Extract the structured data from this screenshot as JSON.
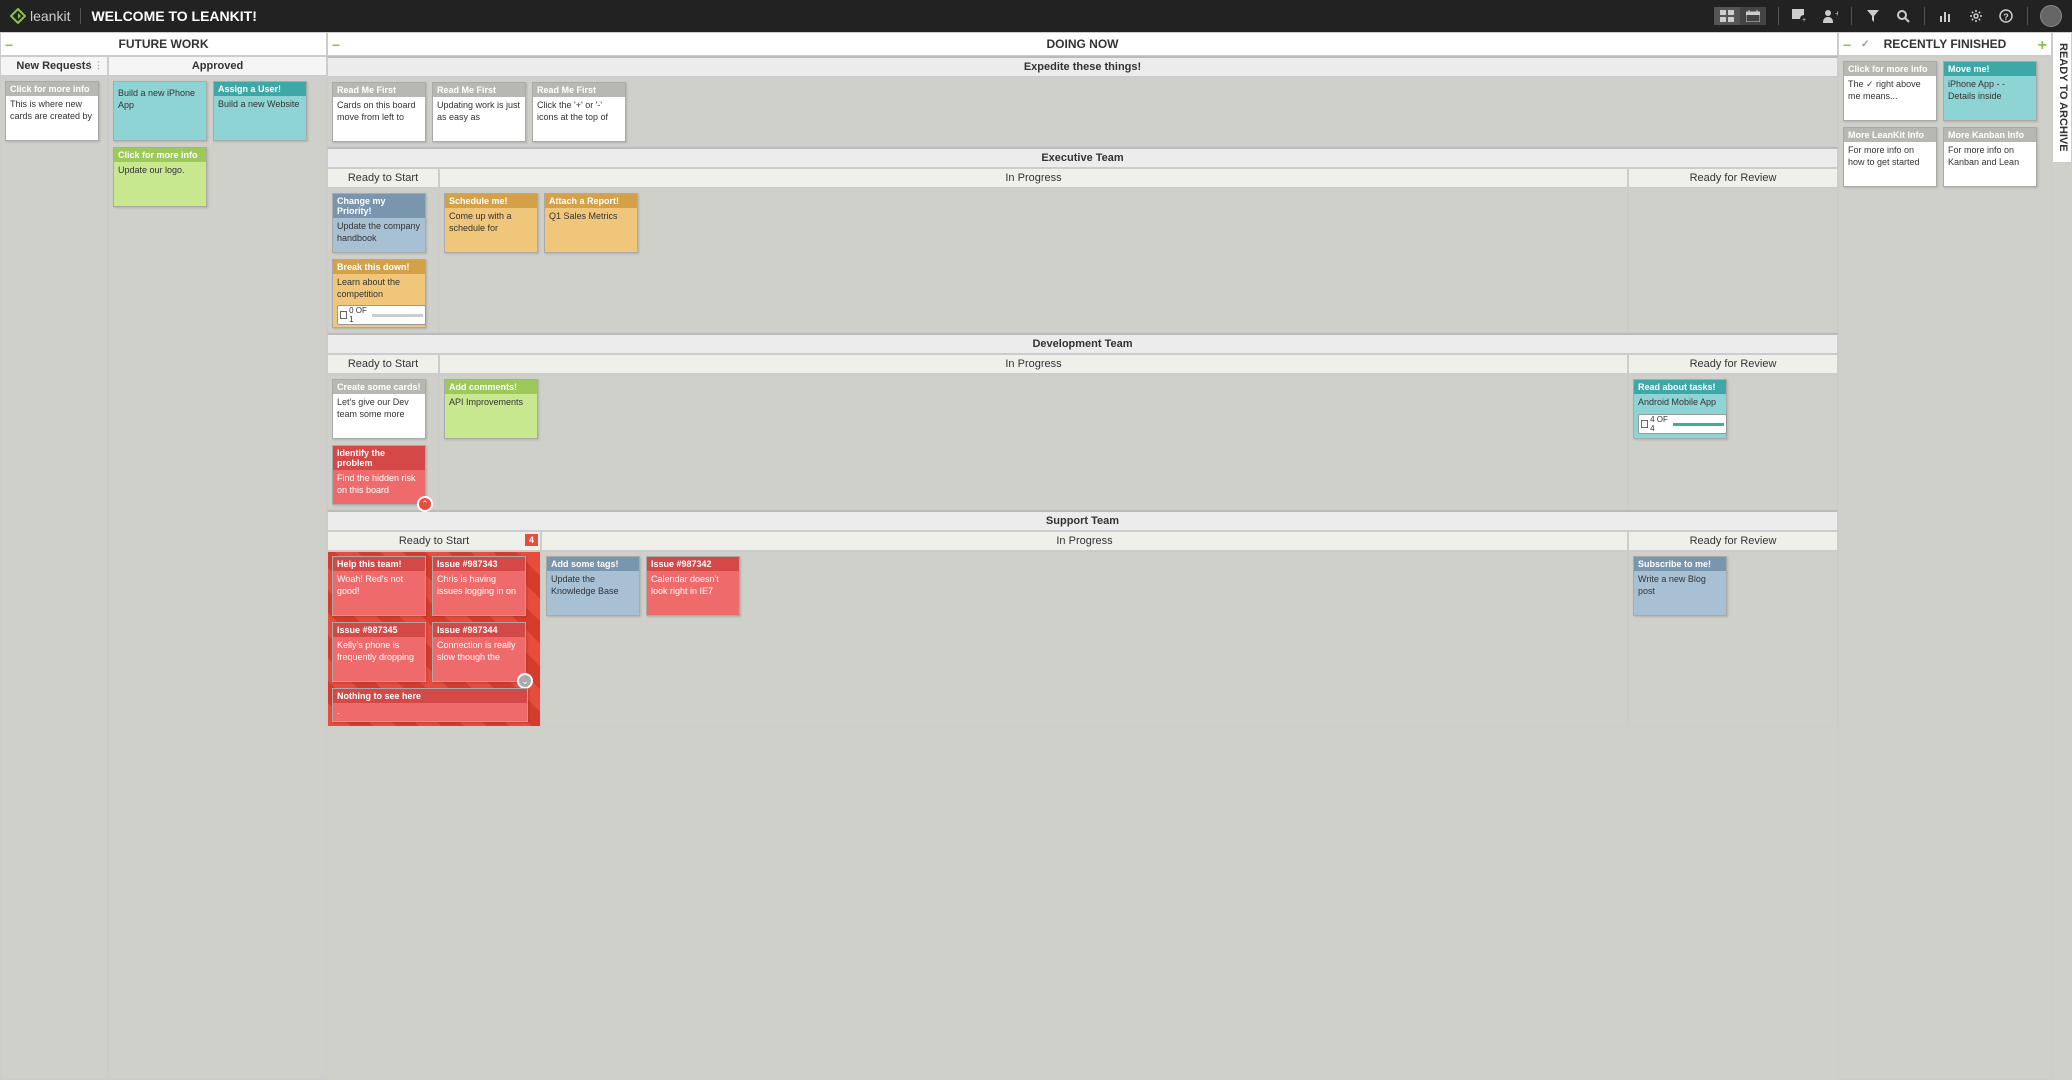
{
  "header": {
    "logo_text": "leankit",
    "title": "WELCOME TO LEANKIT!"
  },
  "groups": {
    "future": {
      "title": "FUTURE WORK"
    },
    "doing": {
      "title": "DOING NOW"
    },
    "recent": {
      "title": "RECENTLY FINISHED"
    },
    "archive": {
      "title": "READY TO ARCHIVE"
    }
  },
  "future": {
    "new_requests": {
      "title": "New Requests",
      "card1": {
        "hdr": "Click for more info",
        "body": "This is where new cards are created by"
      }
    },
    "approved": {
      "title": "Approved",
      "card1": {
        "body": "Build a new iPhone App"
      },
      "card2": {
        "hdr": "Assign a User!",
        "body": "Build a new Website"
      },
      "card3": {
        "hdr": "Click for more info",
        "body": "Update our logo."
      }
    }
  },
  "doing": {
    "expedite": {
      "title": "Expedite these things!",
      "card1": {
        "hdr": "Read Me First",
        "body": "Cards on this board move from left to"
      },
      "card2": {
        "hdr": "Read Me First",
        "body": "Updating work is just as easy as"
      },
      "card3": {
        "hdr": "Read Me First",
        "body": "Click the '+' or '-' icons at the top of"
      }
    },
    "exec": {
      "title": "Executive Team",
      "cols": {
        "ready": "Ready to Start",
        "progress": "In Progress",
        "review": "Ready for Review"
      },
      "ready": {
        "c1": {
          "hdr": "Change my Priority!",
          "body": "Update the company handbook"
        },
        "c2": {
          "hdr": "Break this down!",
          "body": "Learn about the competition",
          "task": "0 OF 1"
        }
      },
      "progress": {
        "c1": {
          "hdr": "Schedule me!",
          "body": "Come up with a schedule for"
        },
        "c2": {
          "hdr": "Attach a Report!",
          "body": "Q1 Sales Metrics"
        }
      }
    },
    "dev": {
      "title": "Development Team",
      "cols": {
        "ready": "Ready to Start",
        "progress": "In Progress",
        "review": "Ready for Review"
      },
      "ready": {
        "c1": {
          "hdr": "Create some cards!",
          "body": "Let's give our Dev team some more"
        },
        "c2": {
          "hdr": "Identify the problem",
          "body": "Find the hidden risk on this board"
        }
      },
      "progress": {
        "c1": {
          "hdr": "Add comments!",
          "body": "API Improvements"
        }
      },
      "review": {
        "c1": {
          "hdr": "Read about tasks!",
          "body": "Android Mobile App",
          "task": "4 OF 4"
        }
      }
    },
    "support": {
      "title": "Support Team",
      "cols": {
        "ready": "Ready to Start",
        "progress": "In Progress",
        "review": "Ready for Review"
      },
      "wip": "4",
      "ready": {
        "c1": {
          "hdr": "Help this team!",
          "body": "Woah! Red's not good!"
        },
        "c2": {
          "hdr": "Issue #987343",
          "body": "Chris is having issues logging in on"
        },
        "c3": {
          "hdr": "Issue #987345",
          "body": "Kelly's phone is frequently dropping"
        },
        "c4": {
          "hdr": "Issue #987344",
          "body": "Connection is really slow though the"
        },
        "c5": {
          "hdr": "Nothing to see here",
          "body": "."
        }
      },
      "progress": {
        "c1": {
          "hdr": "Add some tags!",
          "body": "Update the Knowledge Base"
        },
        "c2": {
          "hdr": "Issue #987342",
          "body": "Calendar doesn't look right in IE7"
        }
      },
      "review": {
        "c1": {
          "hdr": "Subscribe to me!",
          "body": "Write a new Blog post"
        }
      }
    }
  },
  "recent": {
    "c1": {
      "hdr": "Click for more info",
      "body": "The ✓ right above me means..."
    },
    "c2": {
      "hdr": "Move me!",
      "body": "iPhone App - - Details inside"
    },
    "c3": {
      "hdr": "More LeanKit Info",
      "body": "For more info on how to get started"
    },
    "c4": {
      "hdr": "More Kanban Info",
      "body": "For more info on Kanban and Lean"
    }
  }
}
